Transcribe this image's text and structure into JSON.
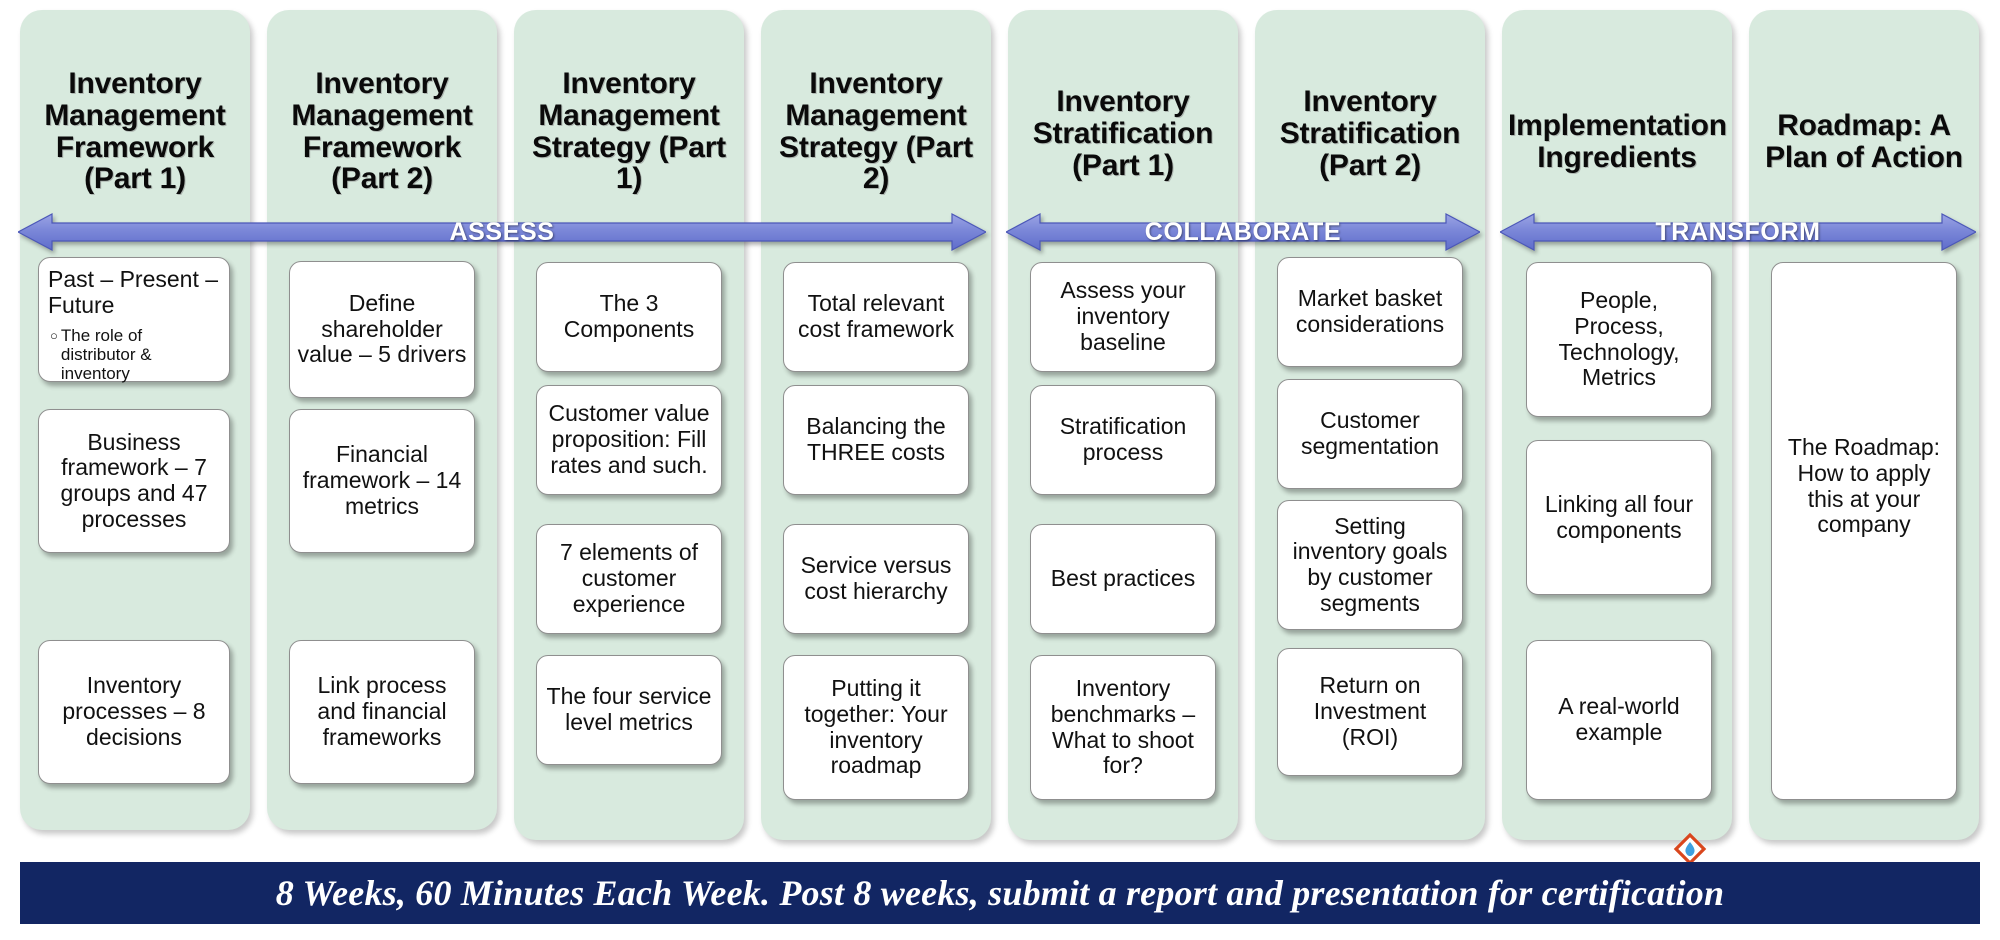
{
  "colors": {
    "column_bg": "#d8eade",
    "box_bg": "#ffffff",
    "arrow_fill": "#7b87d8",
    "banner_bg": "#122663",
    "banner_text": "#ffffff",
    "logo_outer": "#d9461d",
    "logo_inner": "#3fa0e0"
  },
  "phases": [
    {
      "label": "ASSESS"
    },
    {
      "label": "COLLABORATE"
    },
    {
      "label": "TRANSFORM"
    }
  ],
  "columns": [
    {
      "title": "Inventory Management Framework (Part 1)",
      "boxes": [
        {
          "title": "Past – Present – Future",
          "bullet": "The role of distributor & inventory"
        },
        {
          "title": "Business framework – 7 groups and 47 processes"
        },
        {
          "title": "Inventory processes – 8 decisions"
        }
      ]
    },
    {
      "title": "Inventory Management Framework (Part 2)",
      "boxes": [
        {
          "title": "Define shareholder value – 5 drivers"
        },
        {
          "title": "Financial framework – 14 metrics"
        },
        {
          "title": "Link process and financial frameworks"
        }
      ]
    },
    {
      "title": "Inventory Management Strategy (Part 1)",
      "boxes": [
        {
          "title": "The 3 Components"
        },
        {
          "title": "Customer value proposition: Fill rates and such."
        },
        {
          "title": "7 elements of customer experience"
        },
        {
          "title": "The four service level metrics"
        }
      ]
    },
    {
      "title": "Inventory Management Strategy (Part 2)",
      "boxes": [
        {
          "title": "Total relevant cost framework"
        },
        {
          "title": "Balancing the THREE costs"
        },
        {
          "title": "Service versus cost hierarchy"
        },
        {
          "title": "Putting it together: Your inventory roadmap"
        }
      ]
    },
    {
      "title": "Inventory Stratification (Part 1)",
      "boxes": [
        {
          "title": "Assess your inventory baseline"
        },
        {
          "title": "Stratification process"
        },
        {
          "title": "Best practices"
        },
        {
          "title": "Inventory benchmarks – What to shoot for?"
        }
      ]
    },
    {
      "title": "Inventory Stratification (Part 2)",
      "boxes": [
        {
          "title": "Market basket considerations"
        },
        {
          "title": "Customer segmentation"
        },
        {
          "title": "Setting inventory goals by customer segments"
        },
        {
          "title": "Return on Investment (ROI)"
        }
      ]
    },
    {
      "title": "Implementation Ingredients",
      "boxes": [
        {
          "title": "People, Process, Technology, Metrics"
        },
        {
          "title": "Linking all four components"
        },
        {
          "title": "A real-world example"
        }
      ]
    },
    {
      "title": "Roadmap: A Plan of Action",
      "boxes": [
        {
          "title": "The Roadmap: How to apply this at your company"
        }
      ]
    }
  ],
  "banner": {
    "text": "8 Weeks, 60 Minutes Each Week. Post 8 weeks, submit a report and presentation for certification"
  },
  "logo": {
    "name": "diamond-flame-logo"
  }
}
